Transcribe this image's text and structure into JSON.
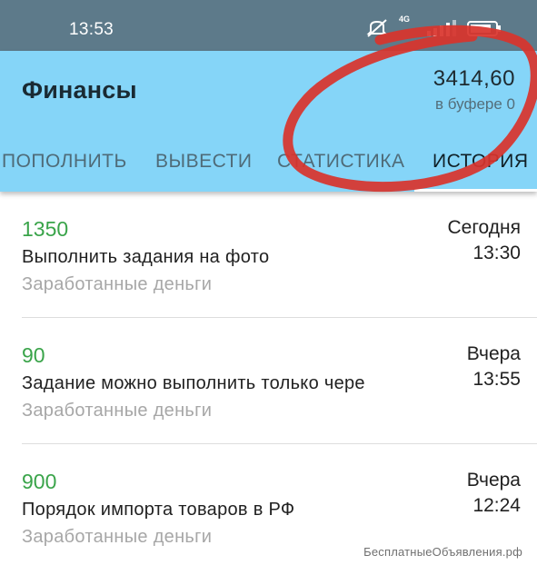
{
  "status_bar": {
    "time": "13:53",
    "network": "4G",
    "icons": [
      "mute-icon",
      "signal-icon",
      "battery-icon"
    ]
  },
  "app_bar": {
    "title": "Финансы",
    "balance": "3414,60",
    "buffer": "в буфере 0",
    "tabs": [
      {
        "label": "ПОПОЛНИТЬ",
        "active": false
      },
      {
        "label": "ВЫВЕСТИ",
        "active": false
      },
      {
        "label": "СТАТИСТИКА",
        "active": false
      },
      {
        "label": "ИСТОРИЯ",
        "active": true
      }
    ]
  },
  "history": [
    {
      "amount": "1350",
      "title": "Выполнить задания на фото",
      "subtitle": "Заработанные деньги",
      "day": "Сегодня",
      "time": "13:30"
    },
    {
      "amount": "90",
      "title": "Задание можно выполнить только чере",
      "subtitle": "Заработанные деньги",
      "day": "Вчера",
      "time": "13:55"
    },
    {
      "amount": "900",
      "title": "Порядок импорта товаров в РФ",
      "subtitle": "Заработанные деньги",
      "day": "Вчера",
      "time": "12:24"
    }
  ],
  "watermark": "БесплатныеОбъявления.рф",
  "colors": {
    "status_bar": "#5d7a8a",
    "app_bar": "#85d5f8",
    "amount": "#3aa44a",
    "annotation": "#d9332b"
  }
}
